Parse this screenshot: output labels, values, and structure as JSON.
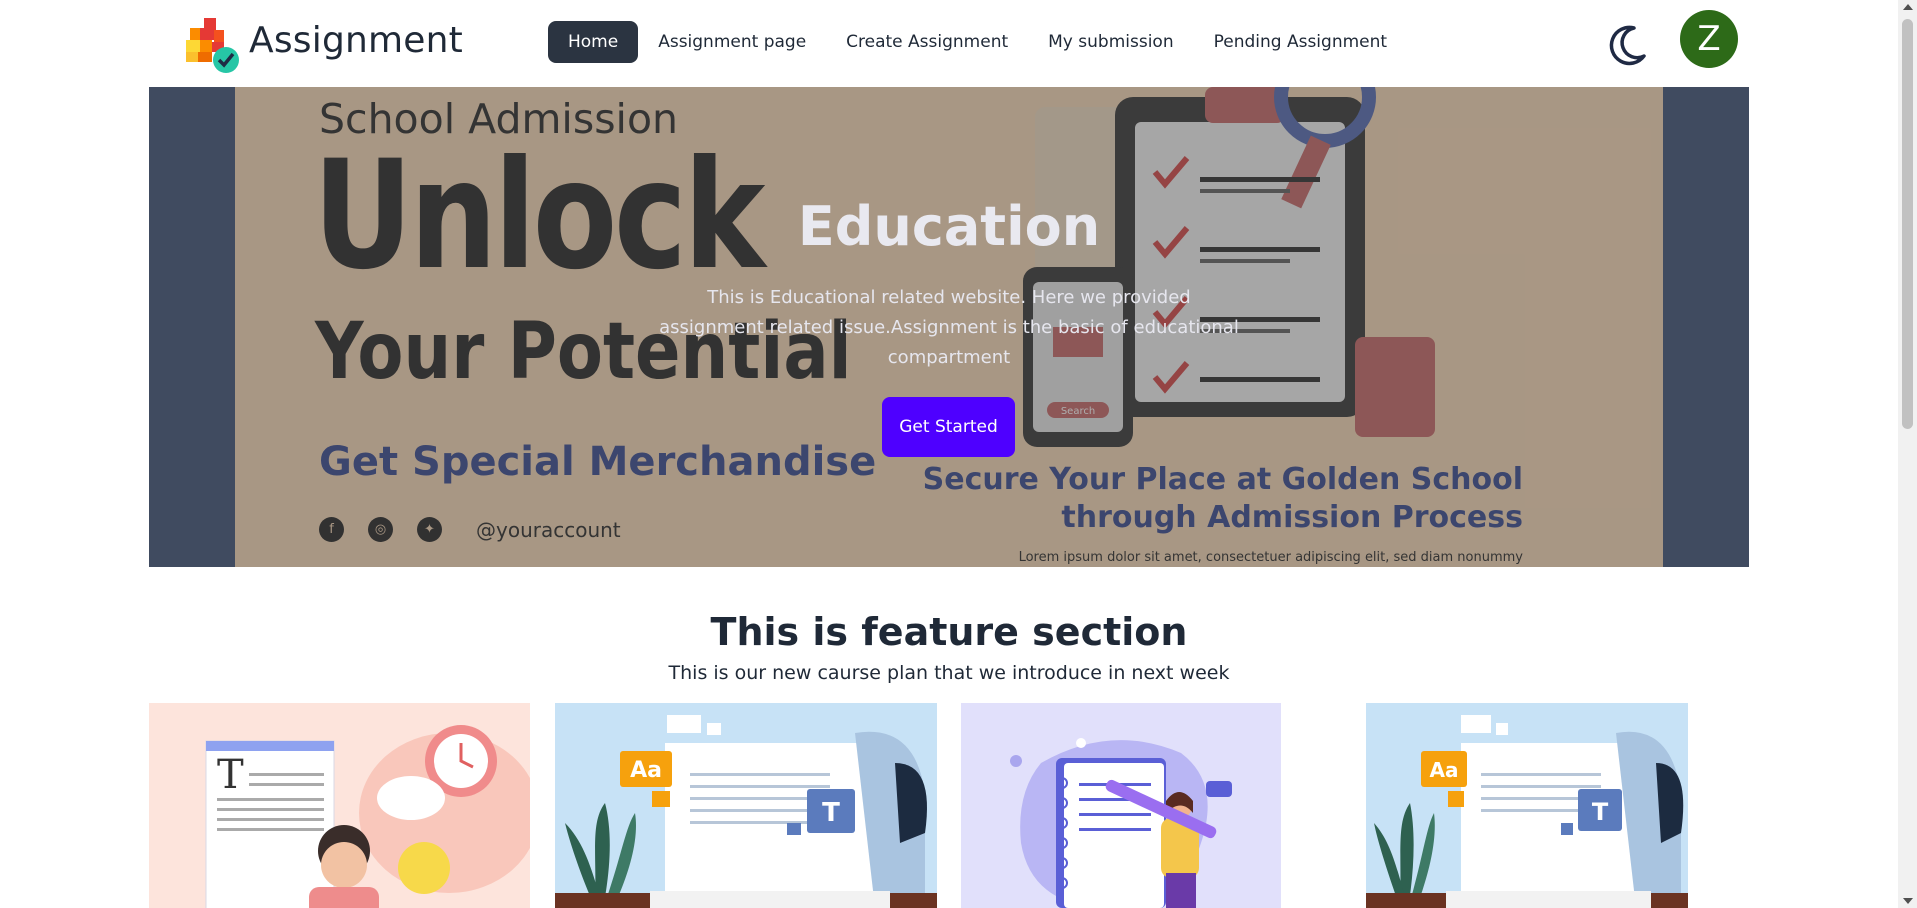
{
  "brand": {
    "name": "Assignment"
  },
  "nav": {
    "items": [
      {
        "label": "Home",
        "active": true
      },
      {
        "label": "Assignment page",
        "active": false
      },
      {
        "label": "Create Assignment",
        "active": false
      },
      {
        "label": "My submission",
        "active": false
      },
      {
        "label": "Pending Assignment",
        "active": false
      }
    ],
    "theme_toggle_icon": "moon-icon",
    "avatar_initial": "Z"
  },
  "hero": {
    "title": "Education",
    "description": "This is Educational related website. Here we provided assignment related issue.Assignment is the basic of educational compartment",
    "button_label": "Get Started",
    "banner": {
      "school_admission": "School Admission",
      "unlock": "Unlock",
      "your_potential": "Your Potential",
      "merchandise": "Get Special Merchandise",
      "handle": "@youraccount",
      "secure_line1": "Secure Your Place at Golden School",
      "secure_line2": "through Admission Process",
      "lorem": "Lorem ipsum dolor sit amet, consectetuer adipiscing elit, sed diam nonummy",
      "search_label": "Search"
    }
  },
  "features": {
    "title": "This is feature section",
    "subtitle": "This is our new caurse plan that we introduce in next week",
    "card_labels": [
      "Aa",
      "T"
    ]
  },
  "colors": {
    "accent": "#4e00ff",
    "nav_active_bg": "#2b3441",
    "avatar_bg": "#2d6a18",
    "hero_frame": "#44577b"
  }
}
